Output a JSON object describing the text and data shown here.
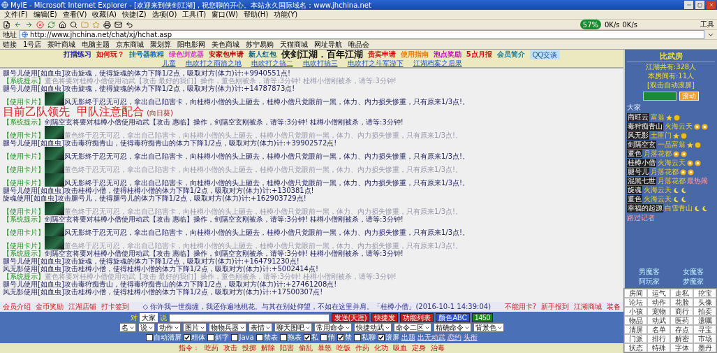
{
  "window": {
    "title": "MyIE - Microsoft Internet Explorer - [欢迎来到侠剑江湖] , 祝您聊的开心。本站永久国际域名：www.jhchina.net"
  },
  "menu": [
    "文件(F)",
    "编辑(E)",
    "查看(V)",
    "收藏(A)",
    "快捷(Z)",
    "选项(O)",
    "工具(T)",
    "窗口(W)",
    "帮助(H)",
    "功能(Y)"
  ],
  "toolbar": {
    "right_label": "工具",
    "speed": "57%",
    "rates": [
      "0K/s",
      "0K/s"
    ]
  },
  "address": {
    "label": "地址",
    "url": "http://www.jhchina.net/chat/xj/hchat.asp"
  },
  "links": {
    "label": "链接",
    "items": [
      "1号店",
      "茶叶商城",
      "电脑主题",
      "京东商城",
      "聚划算",
      "阳电影网",
      "美色商城",
      "苏宁易购",
      "天猫商城",
      "网址导航",
      "唯品会"
    ]
  },
  "banner": {
    "title": "侠剑江湖．百年江湖",
    "left_links": [
      {
        "label": "打擂练习",
        "color": "#1a1aa8"
      },
      {
        "label": "如何玩？",
        "color": "#d01010"
      },
      {
        "label": "挂号器教程",
        "color": "#1070c0"
      },
      {
        "label": "绿色浏览器",
        "color": "#d040d0"
      },
      {
        "label": "安家包申请",
        "color": "#b01010"
      },
      {
        "label": "新人红包",
        "color": "#106080"
      }
    ],
    "right_links": [
      {
        "label": "贵宾申请",
        "color": "#d01010"
      },
      {
        "label": "使用指南",
        "color": "#e08010"
      },
      {
        "label": "泡点奖励",
        "color": "#c010c0"
      },
      {
        "label": "5点月报",
        "color": "#d01010"
      },
      {
        "label": "会员简介",
        "color": "#2080a0"
      }
    ],
    "qq": "QQ交谈",
    "sub_links": [
      "儿童",
      "电吹打之雨箭之地",
      "电吹打之搞二",
      "电吹打搞三",
      "电吹打之斗军游下",
      "江湖档案之后果"
    ]
  },
  "chat": [
    {
      "kind": "line",
      "text": "腿号儿使用[如血虫]攻击旋魂，使得旋魂的体力下降1/2点，吸取对方(体力)计:+9940551点!",
      "faded": false
    },
    {
      "kind": "line",
      "tag": "【系统提示】",
      "text": "董色将要对桂樽小僧使用动武【攻击 最好的我们】操作，董色刚被杀，请等:3分钟! 桂樽小僧刚被杀，请等:3分钟!",
      "faded": true
    },
    {
      "kind": "line",
      "text": "腿号儿使用[如血虫]攻击旋魂，使得旋魂的体力下降1/2点，吸取对方(体力)计:+14787873点!",
      "faded": false
    },
    {
      "kind": "card",
      "tag": "【使用卡片】",
      "text": "风无影终于忍无可忍，拿出自己陷害卡，向桂樽小僧的头上砸去，桂樽小僧只觉眼前一黑，体力、内力损失惨重，只有原来1/3点!。",
      "faded": false
    },
    {
      "kind": "notice",
      "text": "目前乙队领先  甲队注意配合",
      "note": "(向日葵)"
    },
    {
      "kind": "line",
      "tag": "【系统提示】",
      "text": "剑隔空玄将要对桂樽小僧使用动武【攻击 惠临】操作，剑隔空玄刚被杀，请等:3分钟! 桂樽小僧刚被杀，请等:3分钟!",
      "faded": false
    },
    {
      "kind": "card",
      "tag": "【使用卡片】",
      "text": "董色终于忍无可忍，拿出自己陷害卡，向桂樽小僧的头上砸去，桂樽小僧只觉眼前一黑，体力、内力损失惨重，只有原来1/3点!。",
      "faded": true
    },
    {
      "kind": "line",
      "text": "腿号儿使用[如血虫]攻击毒狩痴青山，使得毒狩痴青山的体力下降1/2点，吸取对方(体力)计:+39902572点!",
      "faded": false
    },
    {
      "kind": "card",
      "tag": "【使用卡片】",
      "text": "风无影终于忍无可忍，拿出自己陷害卡，向桂樽小僧的头上砸去，桂樽小僧只觉眼前一黑，体力、内力损失惨重，只有原来1/3点!。",
      "faded": false
    },
    {
      "kind": "card",
      "tag": "【使用卡片】",
      "text": "董色终于忍无可忍，拿出自己陷害卡，向桂樽小僧的头上砸去，桂樽小僧只觉眼前一黑，体力、内力损失惨重，只有原来1/3点!。",
      "faded": true
    },
    {
      "kind": "card",
      "tag": "【使用卡片】",
      "text": "风无影终于忍无可忍，拿出自己陷害卡，向桂樽小僧的头上砸去，桂樽小僧只觉眼前一黑，体力、内力损失惨重，只有原来1/3点!。",
      "faded": false
    },
    {
      "kind": "line",
      "text": "腿号儿使用[如血虫]攻击桂樽小僧，使得桂樽小僧的体力下降1/2点，吸取对方(体力)计:+130381点!",
      "faded": false
    },
    {
      "kind": "line",
      "text": "旋魂使用[如血虫]攻击腿号儿，使得腿号儿的体力下降1/2点，吸取对方(体力)计:+162903729点!",
      "faded": false
    },
    {
      "kind": "card",
      "tag": "【使用卡片】",
      "text": "董色终于忍无可忍，拿出自己陷害卡，向桂樽小僧的头上砸去，桂樽小僧只觉眼前一黑，体力、内力损失惨重，只有原来1/3点!。",
      "faded": true
    },
    {
      "kind": "line",
      "tag": "【系统提示】",
      "text": "剑隔空玄将要对桂樽小僧使用动武【攻击 惠临】操作，剑隔空玄刚被杀，请等:3分钟! 桂樽小僧刚被杀，请等:3分钟!",
      "faded": false
    },
    {
      "kind": "card",
      "tag": "【使用卡片】",
      "text": "风无影终于忍无可忍，拿出自己陷害卡，向桂樽小僧的头上砸去，桂樽小僧只觉眼前一黑，体力、内力损失惨重，只有原来1/3点!。",
      "faded": false
    },
    {
      "kind": "card",
      "tag": "【使用卡片】",
      "text": "董色终于忍无可忍，拿出自己陷害卡，向桂樽小僧的头上砸去，桂樽小僧只觉眼前一黑，体力、内力损失惨重，只有原来1/3点!。",
      "faded": true
    },
    {
      "kind": "line",
      "tag": "【系统提示】",
      "text": "剑隔空玄将要对桂樽小僧使用动武【攻击 惠临】操作，剑隔空玄刚被杀，请等:3分钟! 桂樽小僧刚被杀，请等:3分钟!",
      "faded": false
    },
    {
      "kind": "line",
      "text": "腿号儿使用[如血虫]攻击旋魂，使得旋魂的体力下降1/2点，吸取对方(体力)计:+164791230点!",
      "faded": false
    },
    {
      "kind": "line",
      "text": "风无影使用[如血虫]攻击桂樽小僧，使得桂樽小僧的体力下降1/2点，吸取对方(体力)计:+5002414点!",
      "faded": false
    },
    {
      "kind": "line",
      "tag": "【系统提示】",
      "text": "董色将要对桂樽小僧使用动武【攻击 最好的我们】操作，董色刚被杀，请等:3分钟! 桂樽小僧刚被杀，请等:3分钟!",
      "faded": true
    },
    {
      "kind": "line",
      "text": "腿号儿使用[如血虫]攻击毒狩痴青山，使得毒狩痴青山的体力下降1/2点，吸取对方(体力)计:+27461208点!",
      "faded": false
    },
    {
      "kind": "line",
      "text": "风无影使用[如血虫]攻击桂樽小僧，使得桂樽小僧的体力下降1/2点，吸取对方(体力)计:+17500307点!",
      "faded": false
    }
  ],
  "status_bar": {
    "left": [
      "会员介绍",
      "金币奖励",
      "江湖店铺",
      "打卡签到"
    ],
    "message": "◇ 你许我一世痴缠，我还你遍地桃花。与其在别处仰望，不如在这里并肩。「桂樽小僧」(2016-10-1 14:39:04)",
    "right": [
      "不能用卡?",
      "新手报到",
      "江湖商城",
      "装备"
    ]
  },
  "controls": {
    "to_label": "对",
    "target": "大家",
    "say_label": "说",
    "buttons": [
      {
        "label": "发送(天涯)",
        "color": "#d01818"
      },
      {
        "label": "快捷发",
        "color": "#d01818"
      },
      {
        "label": "功能列表",
        "color": "#c02020"
      },
      {
        "label": "颜色ABC",
        "color": "#3050d0"
      },
      {
        "label": "1450",
        "color": "#208020"
      }
    ],
    "selects": [
      "名",
      "说",
      "动作",
      "图片",
      "物物兵器",
      "表情",
      "聊天图吧",
      "常用命令",
      "快捷动武",
      "命令二区",
      "精确命令",
      "背景色"
    ],
    "checkboxes": [
      {
        "label": "自动清屏",
        "checked": false
      },
      {
        "label": "粗体",
        "checked": true
      },
      {
        "label": "斜字",
        "checked": false
      },
      {
        "label": "Java",
        "checked": false
      },
      {
        "label": "禁表",
        "checked": false
      },
      {
        "label": "拖表",
        "checked": false
      },
      {
        "label": "私",
        "checked": true
      },
      {
        "label": "悄",
        "checked": false
      },
      {
        "label": "禁",
        "checked": true
      },
      {
        "label": "私聊",
        "checked": false
      },
      {
        "label": "滚屏",
        "checked": true
      }
    ],
    "extra_links": [
      "出题",
      "出无动武",
      "恋约",
      "头衔"
    ]
  },
  "commands": {
    "label": "指令：",
    "items": [
      "吃药",
      "攻击",
      "投掷",
      "解除",
      "陷害",
      "偷乱",
      "暴怒",
      "吃饭",
      "作药",
      "化功",
      "吸血",
      "定身",
      "治毒"
    ]
  },
  "room": {
    "title": "比武房",
    "total": "江湖共有:328人",
    "here": "本房间有:11人",
    "hint": "[双击自动滚屏]",
    "scroll_button": "滚动",
    "everyone": "大家",
    "users": [
      {
        "name": "商旺云",
        "title": "富翁",
        "kind": "star"
      },
      {
        "name": "毒狩痴青山",
        "title": "火海云天",
        "kind": "flower"
      },
      {
        "name": "风无影",
        "title": "土匪门",
        "kind": "star"
      },
      {
        "name": "剑隔空玄",
        "title": "一品富翁",
        "kind": "star"
      },
      {
        "name": "董色",
        "title": "月落花都",
        "kind": "flower"
      },
      {
        "name": "桂樽小僧",
        "title": "火海云天",
        "kind": "flower"
      },
      {
        "name": "腿号儿",
        "title": "月落花都",
        "kind": "flower"
      },
      {
        "name": "混黑七世",
        "title": "月落花都",
        "kind": "plain",
        "extra": "最热闹"
      },
      {
        "name": "旋魂",
        "title": "火海云天",
        "kind": "moon"
      },
      {
        "name": "董色",
        "title": "火海云天",
        "kind": "moon"
      },
      {
        "name": "幸福的起源",
        "title": "白雪青山",
        "kind": "moon",
        "extra": "路过记者"
      }
    ],
    "groups": [
      "男魔客",
      "女魔客",
      "阿玩家",
      "梦魔家"
    ],
    "grid": [
      "房间",
      "运气",
      "走私",
      "挖宝",
      "论坛",
      "动作",
      "花脸",
      "头像",
      "小孩",
      "宠物",
      "商行",
      "拍卖",
      "物品",
      "动武",
      "医药",
      "遗嘱",
      "清屏",
      "名单",
      "存点",
      "寻宝",
      "门派",
      "排行",
      "解密",
      "市场",
      "状态",
      "特殊",
      "字体",
      "墨丹"
    ]
  }
}
